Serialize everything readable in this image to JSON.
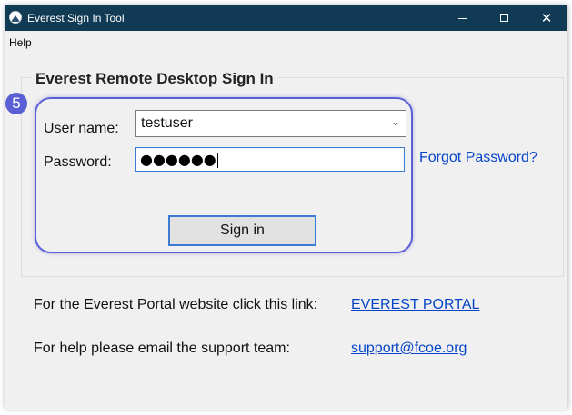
{
  "window": {
    "title": "Everest Sign In Tool",
    "icons": {
      "app": "everest-app-icon",
      "minimize": "minimize-icon",
      "maximize": "maximize-icon",
      "close": "close-icon"
    },
    "close_glyph": "✕"
  },
  "menu": {
    "items": [
      {
        "label": "Help"
      }
    ]
  },
  "signin": {
    "group_title": "Everest Remote Desktop Sign In",
    "step_badge": "5",
    "username_label": "User name:",
    "username_value": "testuser",
    "password_label": "Password:",
    "password_value": "●●●●●●",
    "forgot_link": "Forgot Password?",
    "signin_button": "Sign in",
    "highlight_color": "#5b5fd6"
  },
  "footer": {
    "portal_text": "For the Everest Portal website click this link:",
    "portal_link": "EVEREST PORTAL",
    "help_text": "For help please email the support team:",
    "support_link": "support@fcoe.org"
  },
  "colors": {
    "titlebar": "#113a54",
    "link": "#0645c8",
    "focus": "#3a7bd5"
  }
}
